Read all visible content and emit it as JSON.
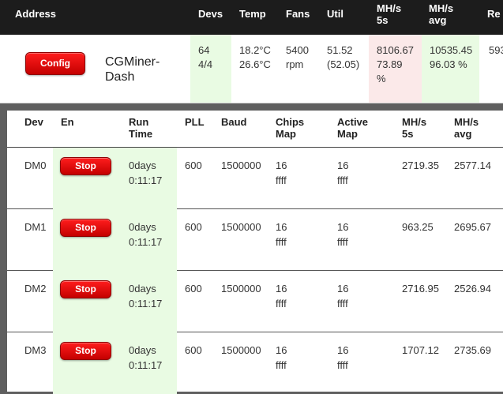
{
  "header": {
    "address": "Address",
    "devs": "Devs",
    "temp": "Temp",
    "fans": "Fans",
    "util": "Util",
    "mhs_5s_line1": "MH/s",
    "mhs_5s_line2": "5s",
    "mhs_avg_line1": "MH/s",
    "mhs_avg_line2": "avg",
    "rej_partial": "Re"
  },
  "summary": {
    "config_label": "Config",
    "app_name_line1": "CGMiner-",
    "app_name_line2": "Dash",
    "devs_line1": "64",
    "devs_line2": "4/4",
    "temp_line1": "18.2°C",
    "temp_line2": "26.6°C",
    "fans_line1": "5400",
    "fans_line2": "rpm",
    "util_line1": "51.52",
    "util_line2": "(52.05)",
    "mhs5s_line1": "8106.67",
    "mhs5s_line2": "73.89",
    "mhs5s_line3": "%",
    "mhsavg_line1": "10535.45",
    "mhsavg_line2": "96.03 %",
    "rej_partial": "593"
  },
  "devices": {
    "headers": {
      "dev": "Dev",
      "en": "En",
      "run_line1": "Run",
      "run_line2": "Time",
      "pll": "PLL",
      "baud": "Baud",
      "chips_line1": "Chips",
      "chips_line2": "Map",
      "active_line1": "Active",
      "active_line2": "Map",
      "mhs5s_line1": "MH/s",
      "mhs5s_line2": "5s",
      "mhsavg_line1": "MH/s",
      "mhsavg_line2": "avg"
    },
    "stop_label": "Stop",
    "rows": [
      {
        "dev": "DM0",
        "run_days": "0days",
        "run_time": "0:11:17",
        "pll": "600",
        "baud": "1500000",
        "chips": "16",
        "chips_map": "ffff",
        "active": "16",
        "active_map": "ffff",
        "mhs5s": "2719.35",
        "mhsavg": "2577.14"
      },
      {
        "dev": "DM1",
        "run_days": "0days",
        "run_time": "0:11:17",
        "pll": "600",
        "baud": "1500000",
        "chips": "16",
        "chips_map": "ffff",
        "active": "16",
        "active_map": "ffff",
        "mhs5s": "963.25",
        "mhsavg": "2695.67"
      },
      {
        "dev": "DM2",
        "run_days": "0days",
        "run_time": "0:11:17",
        "pll": "600",
        "baud": "1500000",
        "chips": "16",
        "chips_map": "ffff",
        "active": "16",
        "active_map": "ffff",
        "mhs5s": "2716.95",
        "mhsavg": "2526.94"
      },
      {
        "dev": "DM3",
        "run_days": "0days",
        "run_time": "0:11:17",
        "pll": "600",
        "baud": "1500000",
        "chips": "16",
        "chips_map": "ffff",
        "active": "16",
        "active_map": "ffff",
        "mhs5s": "1707.12",
        "mhsavg": "2735.69"
      }
    ]
  },
  "colors": {
    "header_bg": "#1c1c1c",
    "good_bg": "#e9fbe3",
    "bad_bg": "#fbe9e9",
    "button_red": "#e00000"
  }
}
